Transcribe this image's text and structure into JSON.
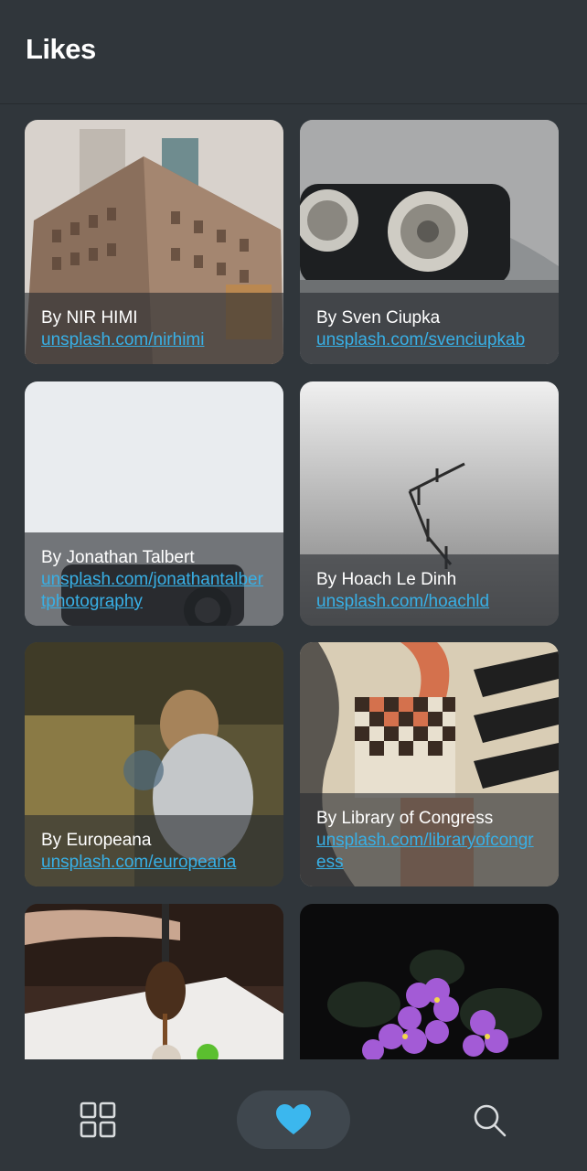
{
  "header": {
    "title": "Likes"
  },
  "cards": [
    {
      "author": "By NIR HIMI",
      "link": "unsplash.com/nirhimi"
    },
    {
      "author": "By Sven Ciupka",
      "link": "unsplash.com/svenciupkab"
    },
    {
      "author": "By Jonathan Talbert",
      "link": "unsplash.com/jonathantalbertphotography"
    },
    {
      "author": "By Hoach Le Dinh",
      "link": "unsplash.com/hoachld"
    },
    {
      "author": "By Europeana",
      "link": "unsplash.com/europeana"
    },
    {
      "author": "By Library of Congress",
      "link": "unsplash.com/libraryofcongress"
    },
    {
      "author": "",
      "link": ""
    },
    {
      "author": "",
      "link": ""
    }
  ],
  "nav": {
    "items": [
      {
        "icon": "grid-icon"
      },
      {
        "icon": "heart-icon",
        "active": true
      },
      {
        "icon": "search-icon"
      }
    ],
    "accent": "#3bb7ee"
  }
}
